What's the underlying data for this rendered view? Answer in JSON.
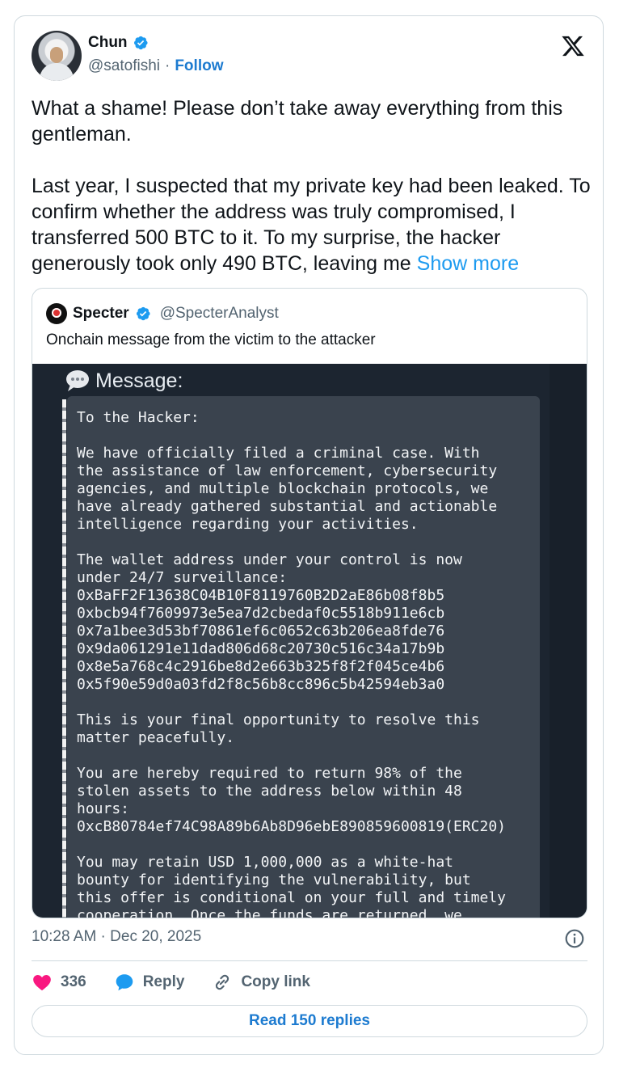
{
  "author": {
    "name": "Chun",
    "handle": "@satofishi",
    "separator": "·",
    "follow_label": "Follow"
  },
  "tweet": {
    "paragraph1": "What a shame! Please don’t take away everything from this gentleman.",
    "paragraph2": "Last year, I suspected that my private key had been leaked. To confirm whether the address was truly compromised, I transferred 500 BTC to it. To my surprise, the hacker generously took only 490 BTC, leaving me",
    "show_more": "Show more"
  },
  "quote": {
    "name": "Specter",
    "handle": "@SpecterAnalyst",
    "text": "Onchain message from the victim to the attacker",
    "image": {
      "title": "Message:",
      "body": "To the Hacker:\n\nWe have officially filed a criminal case. With\nthe assistance of law enforcement, cybersecurity\nagencies, and multiple blockchain protocols, we\nhave already gathered substantial and actionable\nintelligence regarding your activities.\n\nThe wallet address under your control is now\nunder 24/7 surveillance:\n0xBaFF2F13638C04B10F8119760B2D2aE86b08f8b5\n0xbcb94f7609973e5ea7d2cbedaf0c5518b911e6cb\n0x7a1bee3d53bf70861ef6c0652c63b206ea8fde76\n0x9da061291e11dad806d68c20730c516c34a17b9b\n0x8e5a768c4c2916be8d2e663b325f8f2f045ce4b6\n0x5f90e59d0a03fd2f8c56b8cc896c5b42594eb3a0\n\nThis is your final opportunity to resolve this\nmatter peacefully.\n\nYou are hereby required to return 98% of the\nstolen assets to the address below within 48\nhours:\n0xcB80784ef74C98A89b6Ab8D96ebE890859600819(ERC20)\n\nYou may retain USD 1,000,000 as a white-hat\nbounty for identifying the vulnerability, but\nthis offer is conditional on your full and timely\ncooperation. Once the funds are returned, we"
    }
  },
  "meta": {
    "timestamp": "10:28 AM · Dec 20, 2025"
  },
  "actions": {
    "likes": "336",
    "reply_label": "Reply",
    "copy_link_label": "Copy link"
  },
  "read_replies_label": "Read 150 replies",
  "colors": {
    "accent": "#1d9bf0",
    "link": "#1d7bd0",
    "heart": "#f91880",
    "muted": "#536471"
  }
}
